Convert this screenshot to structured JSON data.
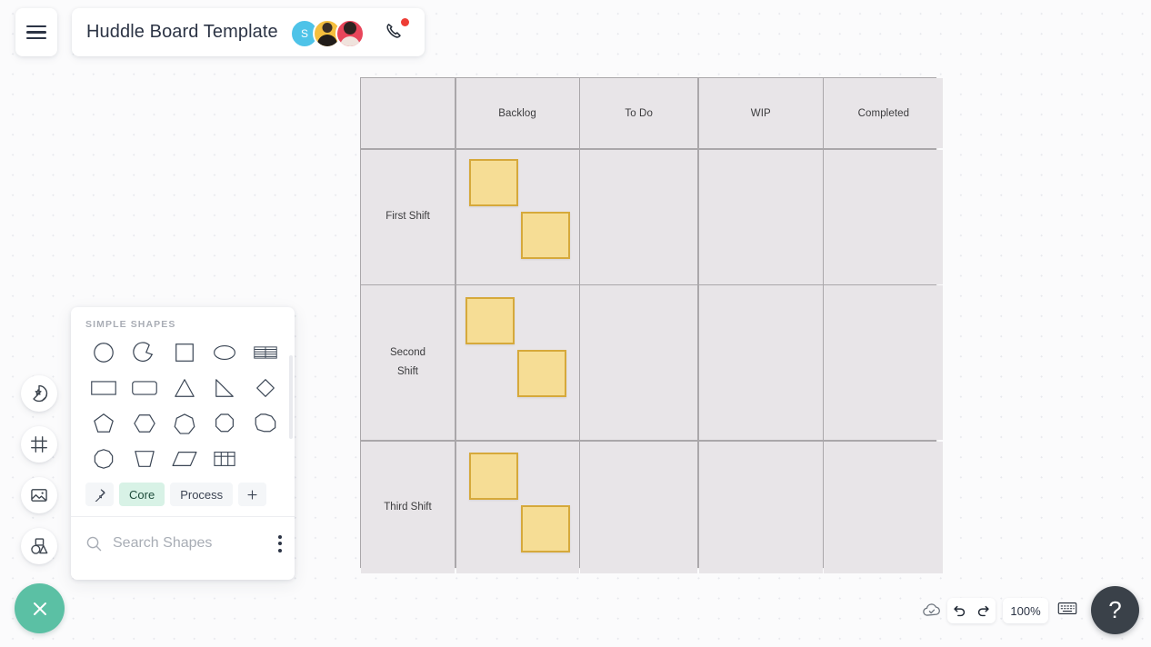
{
  "app": {
    "board_title": "Huddle Board Template",
    "menu_icon": "hamburger-menu-icon",
    "call_icon": "phone-call-icon",
    "accent_teal": "#5bc0a4",
    "note_fill": "#f6dd95",
    "note_border": "#d6a93b",
    "cell_fill": "#e8e5e8",
    "grid_line": "#aaa7aa"
  },
  "collaborators": [
    {
      "initial": "S",
      "name": "avatar-s",
      "color": "#4ec3e8"
    },
    {
      "initial": "",
      "name": "avatar-photo-1",
      "color": "#f5bf3e"
    },
    {
      "initial": "",
      "name": "avatar-photo-2",
      "color": "#e8455a"
    }
  ],
  "rail": {
    "items": [
      {
        "icon": "sticky-note-star-icon",
        "label": "Stickers"
      },
      {
        "icon": "frame-icon",
        "label": "Frame"
      },
      {
        "icon": "image-icon",
        "label": "Image"
      },
      {
        "icon": "shapes-icon",
        "label": "Shapes"
      }
    ],
    "fab_icon": "close-x-icon"
  },
  "shapes_panel": {
    "heading": "SIMPLE SHAPES",
    "shapes": [
      "circle",
      "arc",
      "square",
      "ellipse",
      "striped-table",
      "rectangle",
      "rounded-rectangle",
      "triangle",
      "right-triangle",
      "diamond",
      "pentagon",
      "hexagon",
      "heptagon",
      "octagon",
      "nonagon",
      "decagon",
      "trapezoid",
      "parallelogram",
      "table-grid"
    ],
    "tabs": [
      {
        "label": "",
        "icon": "pin-icon",
        "active": false
      },
      {
        "label": "Core",
        "icon": "",
        "active": true
      },
      {
        "label": "Process",
        "icon": "",
        "active": false
      },
      {
        "label": "",
        "icon": "plus-icon",
        "active": false
      }
    ],
    "search_placeholder": "Search Shapes",
    "search_value": "",
    "search_icon": "search-icon",
    "more_icon": "kebab-menu-icon"
  },
  "board": {
    "columns": [
      "",
      "Backlog",
      "To  Do",
      "WIP",
      "Completed"
    ],
    "rows": [
      {
        "label": "First   Shift",
        "notes_in_backlog": 2
      },
      {
        "label": "Second\nShift",
        "notes_in_backlog": 2
      },
      {
        "label": "Third   Shift",
        "notes_in_backlog": 2
      }
    ],
    "row_labels": [
      "First   Shift",
      "Second Shift",
      "Third   Shift"
    ]
  },
  "statusbar": {
    "cloud_icon": "cloud-saved-icon",
    "undo_icon": "undo-icon",
    "redo_icon": "redo-icon",
    "zoom_level": "100%",
    "keyboard_icon": "keyboard-icon",
    "help_label": "?"
  }
}
